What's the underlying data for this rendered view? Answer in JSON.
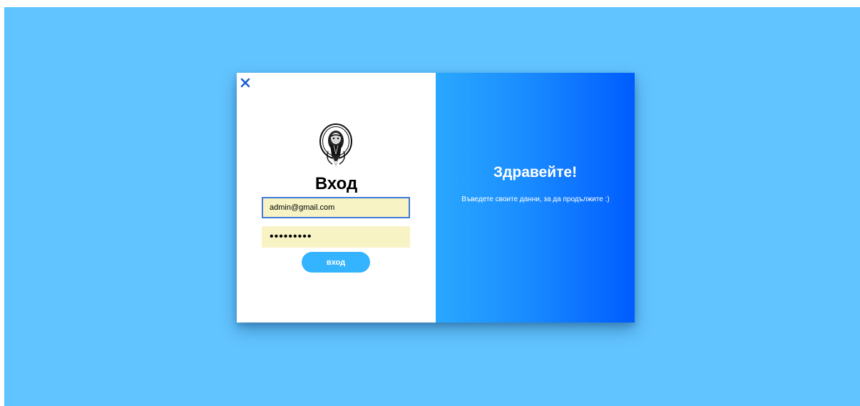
{
  "login": {
    "title": "Вход",
    "email_value": "admin@gmail.com",
    "password_value": "•••••••••",
    "submit_label": "вход"
  },
  "welcome": {
    "title": "Здравейте!",
    "message": "Въведете своите данни, за да продължите :)"
  },
  "icons": {
    "close": "close-icon",
    "logo": "university-seal-logo"
  },
  "colors": {
    "page_background": "#62c4ff",
    "accent": "#34b3ff",
    "gradient_start": "#2aa8ff",
    "gradient_end": "#005cff",
    "field_background": "#f7f3c4",
    "focus_border": "#3d7bd6",
    "close_icon": "#1a5ed6"
  }
}
